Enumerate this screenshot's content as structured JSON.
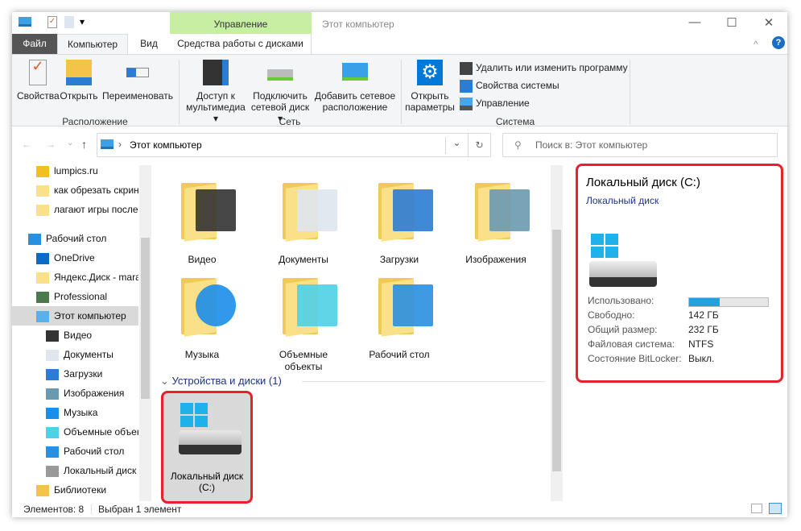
{
  "window": {
    "title": "Этот компьютер",
    "context_tab_header": "Управление",
    "buttons": {
      "minimize": "—",
      "maximize": "☐",
      "close": "✕"
    }
  },
  "quick_access": {
    "dropdown": "▾"
  },
  "tabs": [
    {
      "label": "Файл"
    },
    {
      "label": "Компьютер"
    },
    {
      "label": "Вид"
    },
    {
      "label": "Средства работы с дисками"
    }
  ],
  "ribbon": {
    "location": {
      "label": "Расположение",
      "buttons": [
        "Свойства",
        "Открыть",
        "Переименовать"
      ]
    },
    "network": {
      "label": "Сеть",
      "buttons": [
        "Доступ к мультимедиа ▾",
        "Подключить сетевой диск ▾",
        "Добавить сетевое расположение"
      ]
    },
    "system": {
      "label": "Система",
      "open_settings": "Открыть параметры",
      "items": [
        "Удалить или изменить программу",
        "Свойства системы",
        "Управление"
      ]
    }
  },
  "address": {
    "path": "Этот компьютер",
    "search_placeholder": "Поиск в: Этот компьютер"
  },
  "nav": {
    "items": [
      {
        "label": "lumpics.ru",
        "icon": "warning-icon"
      },
      {
        "label": "как обрезать скрин",
        "icon": "folder-icon"
      },
      {
        "label": "лагают игры после",
        "icon": "folder-icon"
      },
      {
        "label": "Рабочий стол",
        "icon": "desktop-icon"
      },
      {
        "label": "OneDrive",
        "icon": "cloud-icon"
      },
      {
        "label": "Яндекс.Диск - mara",
        "icon": "folder-icon"
      },
      {
        "label": "Professional",
        "icon": "user-icon"
      },
      {
        "label": "Этот компьютер",
        "icon": "computer-icon",
        "selected": true
      },
      {
        "label": "Видео",
        "icon": "video-icon"
      },
      {
        "label": "Документы",
        "icon": "document-icon"
      },
      {
        "label": "Загрузки",
        "icon": "download-icon"
      },
      {
        "label": "Изображения",
        "icon": "image-icon"
      },
      {
        "label": "Музыка",
        "icon": "music-icon"
      },
      {
        "label": "Объемные объек",
        "icon": "cube-icon"
      },
      {
        "label": "Рабочий стол",
        "icon": "desktop-icon"
      },
      {
        "label": "Локальный диск (",
        "icon": "drive-icon"
      },
      {
        "label": "Библиотеки",
        "icon": "library-icon"
      }
    ]
  },
  "folders": [
    {
      "label": "Видео",
      "icon": "video-icon"
    },
    {
      "label": "Документы",
      "icon": "document-icon"
    },
    {
      "label": "Загрузки",
      "icon": "download-icon"
    },
    {
      "label": "Изображения",
      "icon": "image-icon"
    },
    {
      "label": "Музыка",
      "icon": "music-icon"
    },
    {
      "label": "Объемные объекты",
      "icon": "cube-icon"
    },
    {
      "label": "Рабочий стол",
      "icon": "desktop-icon"
    }
  ],
  "devices": {
    "header": "Устройства и диски (1)",
    "drive": {
      "label": "Локальный диск (C:)"
    }
  },
  "details": {
    "title": "Локальный диск (C:)",
    "subtitle": "Локальный диск",
    "used_fraction": 0.39,
    "rows": [
      {
        "label": "Использовано:",
        "value": ""
      },
      {
        "label": "Свободно:",
        "value": "142 ГБ"
      },
      {
        "label": "Общий размер:",
        "value": "232 ГБ"
      },
      {
        "label": "Файловая система:",
        "value": "NTFS"
      },
      {
        "label": "Состояние BitLocker:",
        "value": "Выкл."
      }
    ]
  },
  "status": {
    "count": "Элементов: 8",
    "selected": "Выбран 1 элемент"
  },
  "colors": {
    "accent": "#0078d7",
    "highlight": "#ff0000",
    "context_tab": "#c6efa2",
    "bar": "#26a0da"
  }
}
